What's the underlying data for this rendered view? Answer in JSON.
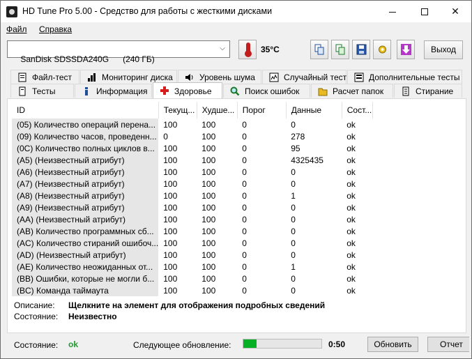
{
  "window": {
    "title": "HD Tune Pro 5.00 - Средство для работы с жесткими дисками"
  },
  "menu": {
    "file": "Файл",
    "help": "Справка"
  },
  "toolbar": {
    "drive": "SanDisk SDSSDA240G      (240 ГБ)",
    "temperature": "35°C",
    "exit_label": "Выход",
    "icons": [
      "copy-icon",
      "copy-all-icon",
      "save-icon",
      "options-icon",
      "download-icon"
    ]
  },
  "tabs_top": [
    {
      "label": "Файл-тест",
      "icon": "file-test-icon"
    },
    {
      "label": "Мониторинг диска",
      "icon": "chart-icon"
    },
    {
      "label": "Уровень шума",
      "icon": "speaker-icon"
    },
    {
      "label": "Случайный тест",
      "icon": "random-test-icon"
    },
    {
      "label": "Дополнительные тесты",
      "icon": "extra-tests-icon"
    }
  ],
  "tabs_bottom": [
    {
      "label": "Тесты",
      "icon": "benchmark-icon"
    },
    {
      "label": "Информация",
      "icon": "info-icon"
    },
    {
      "label": "Здоровье",
      "icon": "health-cross-icon"
    },
    {
      "label": "Поиск ошибок",
      "icon": "magnifier-icon"
    },
    {
      "label": "Расчет папок",
      "icon": "folder-icon"
    },
    {
      "label": "Стирание",
      "icon": "erase-icon"
    }
  ],
  "table": {
    "headers": [
      "ID",
      "Текущ...",
      "Худше...",
      "Порог",
      "Данные",
      "Сост..."
    ],
    "rows": [
      [
        "(05) Количество операций перена...",
        "100",
        "100",
        "0",
        "0",
        "ok"
      ],
      [
        "(09) Количество часов, проведенн...",
        "0",
        "100",
        "0",
        "278",
        "ok"
      ],
      [
        "(0C) Количество полных циклов в...",
        "100",
        "100",
        "0",
        "95",
        "ok"
      ],
      [
        "(A5) (Неизвестный атрибут)",
        "100",
        "100",
        "0",
        "4325435",
        "ok"
      ],
      [
        "(A6) (Неизвестный атрибут)",
        "100",
        "100",
        "0",
        "0",
        "ok"
      ],
      [
        "(A7) (Неизвестный атрибут)",
        "100",
        "100",
        "0",
        "0",
        "ok"
      ],
      [
        "(A8) (Неизвестный атрибут)",
        "100",
        "100",
        "0",
        "1",
        "ok"
      ],
      [
        "(A9) (Неизвестный атрибут)",
        "100",
        "100",
        "0",
        "0",
        "ok"
      ],
      [
        "(AA) (Неизвестный атрибут)",
        "100",
        "100",
        "0",
        "0",
        "ok"
      ],
      [
        "(AB) Количество программных сб...",
        "100",
        "100",
        "0",
        "0",
        "ok"
      ],
      [
        "(AC) Количество стираний ошибоч...",
        "100",
        "100",
        "0",
        "0",
        "ok"
      ],
      [
        "(AD) (Неизвестный атрибут)",
        "100",
        "100",
        "0",
        "0",
        "ok"
      ],
      [
        "(AE) Количество неожиданных от...",
        "100",
        "100",
        "0",
        "1",
        "ok"
      ],
      [
        "(BB) Ошибки, которые не могли б...",
        "100",
        "100",
        "0",
        "0",
        "ok"
      ],
      [
        "(BC) Команда таймаута",
        "100",
        "100",
        "0",
        "0",
        "ok"
      ]
    ]
  },
  "details": {
    "description_label": "Описание:",
    "description_value": "Щелкните на элемент для отображения подробных сведений",
    "state_label": "Состояние:",
    "state_value": "Неизвестно"
  },
  "status": {
    "label": "Состояние:",
    "value": "ok",
    "value_color": "#1f9a2c",
    "next_update_label": "Следующее обновление:",
    "progress_fraction": 0.17,
    "timer": "0:50",
    "refresh_label": "Обновить",
    "report_label": "Отчет"
  }
}
